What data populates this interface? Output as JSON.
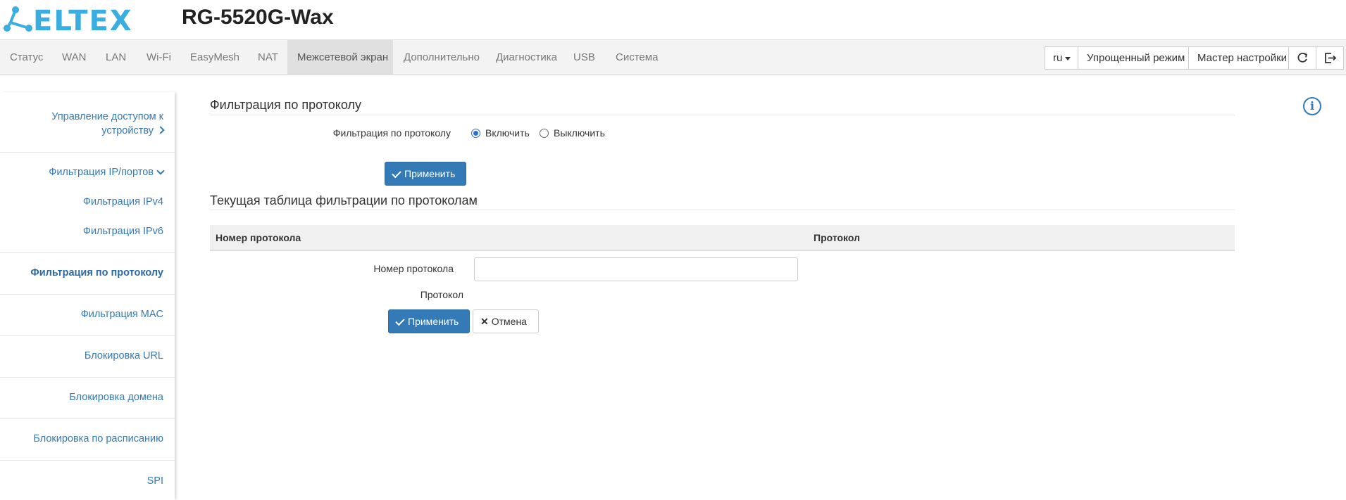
{
  "header": {
    "logo_text": "ELTEX",
    "model": "RG-5520G-Wax"
  },
  "nav": {
    "items": [
      {
        "label": "Статус"
      },
      {
        "label": "WAN"
      },
      {
        "label": "LAN"
      },
      {
        "label": "Wi-Fi"
      },
      {
        "label": "EasyMesh"
      },
      {
        "label": "NAT"
      },
      {
        "label": "Межсетевой экран",
        "active": true
      },
      {
        "label": "Дополнительно"
      },
      {
        "label": "Диагностика"
      },
      {
        "label": "USB"
      },
      {
        "label": "Система"
      }
    ],
    "language": "ru",
    "simple_mode": "Упрощенный режим",
    "wizard": "Мастер настройки",
    "refresh_icon": "refresh-icon",
    "logout_icon": "logout-icon"
  },
  "sidebar": {
    "items": [
      {
        "label_line1": "Управление доступом к",
        "label_line2": "устройству"
      },
      {
        "label": "Фильтрация IP/портов"
      },
      {
        "label": "Фильтрация IPv4"
      },
      {
        "label": "Фильтрация IPv6"
      },
      {
        "label": "Фильтрация по протоколу",
        "active": true
      },
      {
        "label": "Фильтрация MAC"
      },
      {
        "label": "Блокировка URL"
      },
      {
        "label": "Блокировка домена"
      },
      {
        "label": "Блокировка по расписанию"
      },
      {
        "label": "SPI"
      }
    ]
  },
  "main": {
    "section1_title": "Фильтрация по протоколу",
    "filter_label": "Фильтрация по протоколу",
    "radio_enable": "Включить",
    "radio_disable": "Выключить",
    "radio_selected": "Включить",
    "apply_label": "Применить",
    "section2_title": "Текущая таблица фильтрации по протоколам",
    "table_headers": [
      "Номер протокола",
      "Протокол"
    ],
    "form": {
      "protocol_number_label": "Номер протокола",
      "protocol_number_value": "",
      "protocol_label": "Протокол",
      "apply_label": "Применить",
      "cancel_label": "Отмена"
    }
  },
  "colors": {
    "accent": "#337ab7",
    "logo": "#3aaee0",
    "link": "#3579b5"
  }
}
